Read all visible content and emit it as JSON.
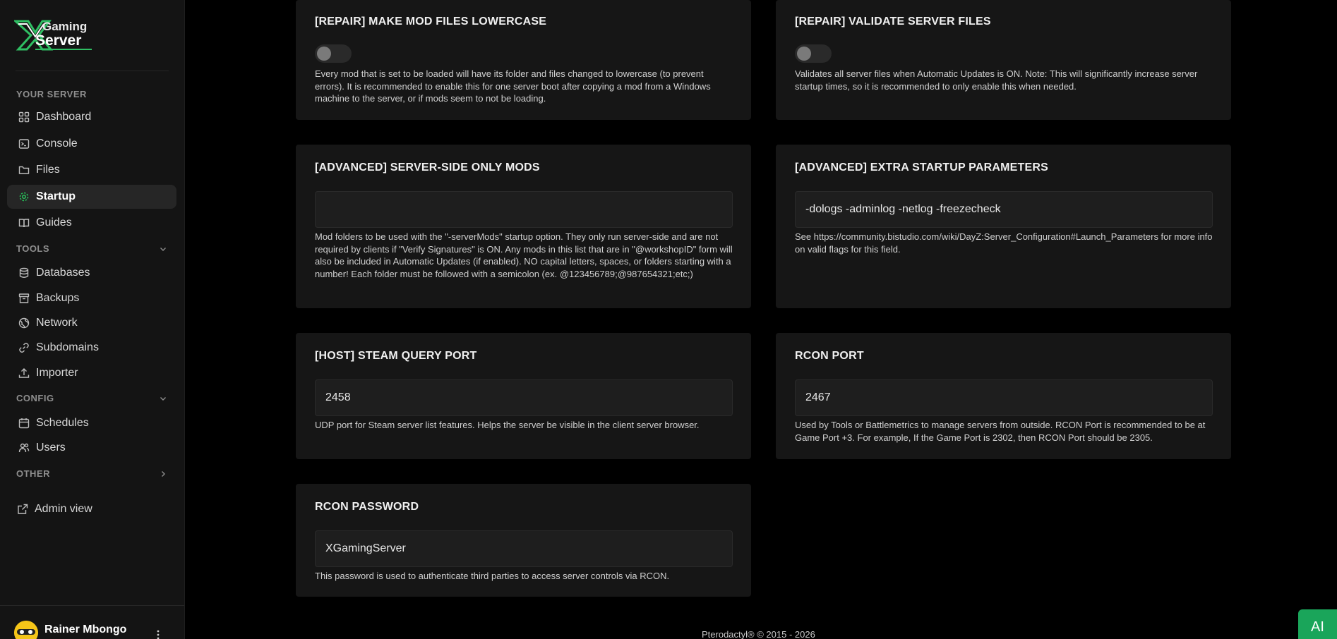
{
  "sidebar": {
    "logo_top": "Gaming",
    "logo_bottom": "Server",
    "sections": {
      "your_server": "YOUR SERVER",
      "tools": "TOOLS",
      "config": "CONFIG",
      "other": "OTHER"
    },
    "items": {
      "dashboard": "Dashboard",
      "console": "Console",
      "files": "Files",
      "startup": "Startup",
      "guides": "Guides",
      "databases": "Databases",
      "backups": "Backups",
      "network": "Network",
      "subdomains": "Subdomains",
      "importer": "Importer",
      "schedules": "Schedules",
      "users": "Users",
      "admin_view": "Admin view"
    },
    "user_name": "Rainer Mbongo",
    "active_color": "#27c15a"
  },
  "cards": {
    "lowercase": {
      "title": "[REPAIR] MAKE MOD FILES LOWERCASE",
      "desc": "Every mod that is set to be loaded will have its folder and files changed to lowercase (to prevent errors). It is recommended to enable this for one server boot after copying a mod from a Windows machine to the server, or if mods seem to not be loading."
    },
    "validate": {
      "title": "[REPAIR] VALIDATE SERVER FILES",
      "desc": "Validates all server files when Automatic Updates is ON. Note: This will significantly increase server startup times, so it is recommended to only enable this when needed."
    },
    "server_mods": {
      "title": "[ADVANCED] SERVER-SIDE ONLY MODS",
      "value": "",
      "desc": "Mod folders to be used with the \"-serverMods\" startup option. They only run server-side and are not required by clients if \"Verify Signatures\" is ON. Any mods in this list that are in \"@workshopID\" form will also be included in Automatic Updates (if enabled). NO capital letters, spaces, or folders starting with a number! Each folder must be followed with a semicolon (ex. @123456789;@987654321;etc;)"
    },
    "extra_params": {
      "title": "[ADVANCED] EXTRA STARTUP PARAMETERS",
      "value": "-dologs -adminlog -netlog -freezecheck",
      "desc": "See https://community.bistudio.com/wiki/DayZ:Server_Configuration#Launch_Parameters for more info on valid flags for this field."
    },
    "query_port": {
      "title": "[HOST] STEAM QUERY PORT",
      "value": "2458",
      "desc": "UDP port for Steam server list features. Helps the server be visible in the client server browser."
    },
    "rcon_port": {
      "title": "RCON PORT",
      "value": "2467",
      "desc": "Used by Tools or Battlemetrics to manage servers from outside. RCON Port is recommended to be at Game Port +3. For example, If the Game Port is 2302, then RCON Port should be 2305."
    },
    "rcon_password": {
      "title": "RCON PASSWORD",
      "value": "XGamingServer",
      "desc": "This password is used to authenticate third parties to access server controls via RCON."
    }
  },
  "footer": "Pterodactyl® © 2015 - 2026",
  "ai_button": "AI"
}
